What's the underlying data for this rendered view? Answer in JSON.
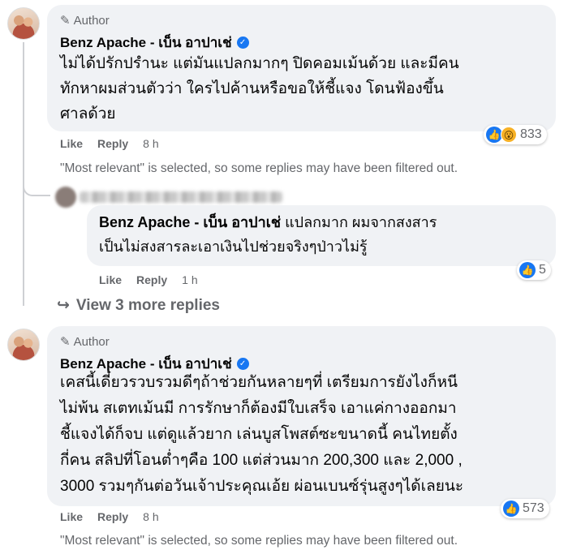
{
  "comment1": {
    "author_badge": "Author",
    "name": "Benz Apache - เบ็น อาปาเช่",
    "lines": [
      "ไม่ได้ปรักปรำนะ แต่มันแปลกมากๆ ปิดคอมเม้นด้วย และมีคน",
      "ทักหาผมส่วนตัวว่า ใครไปค้านหรือขอให้ชี้แจง โดนฟ้องขึ้น",
      "ศาลด้วย"
    ],
    "like_label": "Like",
    "reply_label": "Reply",
    "time": "8 h",
    "reaction_count": "833",
    "filter_note": "\"Most relevant\" is selected, so some replies may have been filtered out."
  },
  "reply1": {
    "name": "Benz Apache - เบ็น อาปาเช่",
    "text_line1": "แปลกมาก ผมจากสงสาร",
    "text_line2": "เป็นไม่สงสารละเอาเงินไปช่วยจริงๆป่าวไม่รู้",
    "like_label": "Like",
    "reply_label": "Reply",
    "time": "1 h",
    "reaction_count": "5"
  },
  "view_more": "View 3 more replies",
  "comment2": {
    "author_badge": "Author",
    "name": "Benz Apache - เบ็น อาปาเช่",
    "lines": [
      "เคสนี้เดี๋ยวรวบรวมดีๆถ้าช่วยกันหลายๆที่ เตรียมการยังไงก็หนี",
      "ไม่พ้น สเตทเม้นมี การรักษาก็ต้องมีใบเสร็จ เอาแค่กางออกมา",
      "ชี้แจงได้ก็จบ แต่ดูแล้วยาก เล่นบูสโพสต์ซะขนาดนี้ คนไทยตั้ง",
      "กี่คน สลิปที่โอนต่ำๆคือ 100 แต่ส่วนมาก 200,300 และ 2,000 ,",
      "3000 รวมๆกันต่อวันเจ้าประคุณเอ้ย ผ่อนเบนซ์รุ่นสูงๆได้เลยนะ"
    ],
    "like_label": "Like",
    "reply_label": "Reply",
    "time": "8 h",
    "reaction_count": "573",
    "filter_note": "\"Most relevant\" is selected, so some replies may have been filtered out."
  },
  "colors": {
    "accent": "#1877f2",
    "bubble": "#f0f2f5",
    "muted": "#65676b"
  }
}
